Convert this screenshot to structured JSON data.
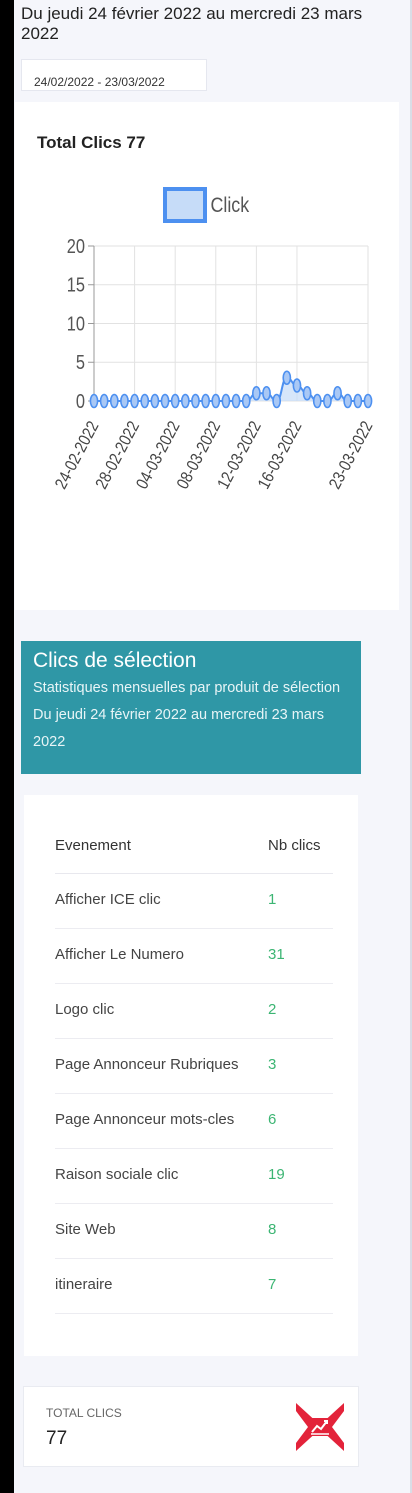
{
  "period": {
    "title": "Du jeudi 24 février 2022 au mercredi 23 mars 2022",
    "range": "24/02/2022 - 23/03/2022"
  },
  "chart": {
    "heading": "Total Clics 77",
    "legend": "Click",
    "colors": {
      "line": "#4d90f0",
      "fill": "#c6dcf8",
      "grid": "#e2e2e2"
    }
  },
  "chart_data": {
    "type": "line",
    "title": "Total Clics 77",
    "xlabel": "",
    "ylabel": "",
    "ylim": [
      0,
      20
    ],
    "yticks": [
      "0",
      "5",
      "10",
      "15",
      "20"
    ],
    "xticks": [
      "24-02-2022",
      "28-02-2022",
      "04-03-2022",
      "08-03-2022",
      "12-03-2022",
      "16-03-2022",
      "23-03-2022"
    ],
    "series": [
      {
        "name": "Click",
        "x": [
          "24-02-2022",
          "25-02-2022",
          "26-02-2022",
          "27-02-2022",
          "28-02-2022",
          "01-03-2022",
          "02-03-2022",
          "03-03-2022",
          "04-03-2022",
          "05-03-2022",
          "06-03-2022",
          "07-03-2022",
          "08-03-2022",
          "09-03-2022",
          "10-03-2022",
          "11-03-2022",
          "12-03-2022",
          "13-03-2022",
          "14-03-2022",
          "15-03-2022",
          "16-03-2022",
          "17-03-2022",
          "18-03-2022",
          "19-03-2022",
          "20-03-2022",
          "21-03-2022",
          "22-03-2022",
          "23-03-2022"
        ],
        "values": [
          0,
          0,
          0,
          0,
          0,
          0,
          0,
          0,
          0,
          0,
          0,
          0,
          0,
          0,
          0,
          0,
          1,
          1,
          0,
          3,
          2,
          1,
          0,
          0,
          1,
          0,
          0,
          0
        ]
      }
    ],
    "legend": "top-center",
    "grid": true
  },
  "selection": {
    "title": "Clics de sélection",
    "subtitle": "Statistiques mensuelles par produit de sélection Du jeudi 24 février 2022 au mercredi 23 mars 2022"
  },
  "table": {
    "headers": [
      "Evenement",
      "Nb clics"
    ],
    "rows": [
      {
        "name": "Afficher ICE clic",
        "value": "1"
      },
      {
        "name": "Afficher Le Numero",
        "value": "31"
      },
      {
        "name": "Logo clic",
        "value": "2"
      },
      {
        "name": "Page Annonceur Rubriques",
        "value": "3"
      },
      {
        "name": "Page Annonceur mots-cles",
        "value": "6"
      },
      {
        "name": "Raison sociale clic",
        "value": "19"
      },
      {
        "name": "Site Web",
        "value": "8"
      },
      {
        "name": "itineraire",
        "value": "7"
      }
    ]
  },
  "summary": {
    "label": "TOTAL CLICS",
    "value": "77",
    "icon": "trending-chart-icon",
    "icon_color": "#e3233a"
  }
}
